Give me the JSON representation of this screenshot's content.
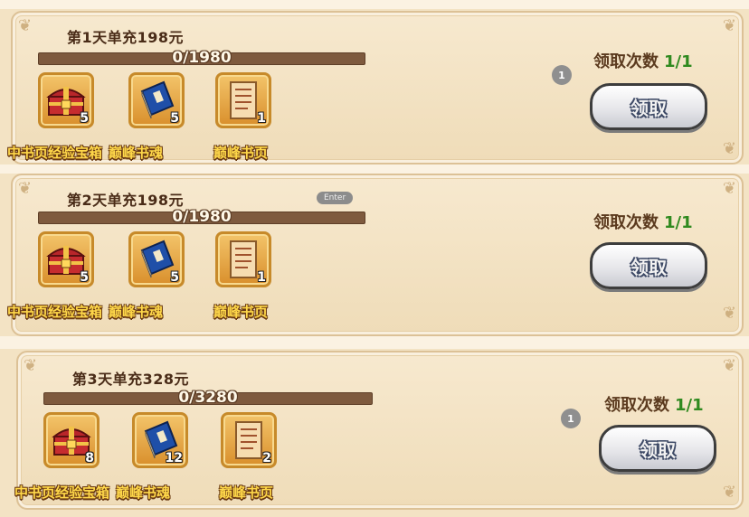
{
  "rewards": [
    {
      "title": "第1天单充198元",
      "progress_text": "0/1980",
      "progress_fraction": 0,
      "items": [
        {
          "name": "中书页经验宝箱",
          "qty": "5",
          "icon": "treasure-chest-icon"
        },
        {
          "name": "巅峰书魂",
          "qty": "5",
          "icon": "blue-book-icon"
        },
        {
          "name": "巅峰书页",
          "qty": "1",
          "icon": "scroll-page-icon"
        }
      ],
      "count_label": "领取次数",
      "count_value": "1/1",
      "button_label": "领取",
      "badge": "1"
    },
    {
      "title": "第2天单充198元",
      "progress_text": "0/1980",
      "progress_fraction": 0,
      "items": [
        {
          "name": "中书页经验宝箱",
          "qty": "5",
          "icon": "treasure-chest-icon"
        },
        {
          "name": "巅峰书魂",
          "qty": "5",
          "icon": "blue-book-icon"
        },
        {
          "name": "巅峰书页",
          "qty": "1",
          "icon": "scroll-page-icon"
        }
      ],
      "count_label": "领取次数",
      "count_value": "1/1",
      "button_label": "领取",
      "overlay": "Enter"
    },
    {
      "title": "第3天单充328元",
      "progress_text": "0/3280",
      "progress_fraction": 0,
      "items": [
        {
          "name": "中书页经验宝箱",
          "qty": "8",
          "icon": "treasure-chest-icon"
        },
        {
          "name": "巅峰书魂",
          "qty": "12",
          "icon": "blue-book-icon"
        },
        {
          "name": "巅峰书页",
          "qty": "2",
          "icon": "scroll-page-icon"
        }
      ],
      "count_label": "领取次数",
      "count_value": "1/1",
      "button_label": "领取",
      "badge": "1"
    }
  ],
  "colors": {
    "panel_bg": "#f3e2c2",
    "progress_bar": "#7e5a3e",
    "item_name": "#ffd84a",
    "count_value": "#2f8a1f",
    "button_text_outline": "#3e4a66"
  }
}
